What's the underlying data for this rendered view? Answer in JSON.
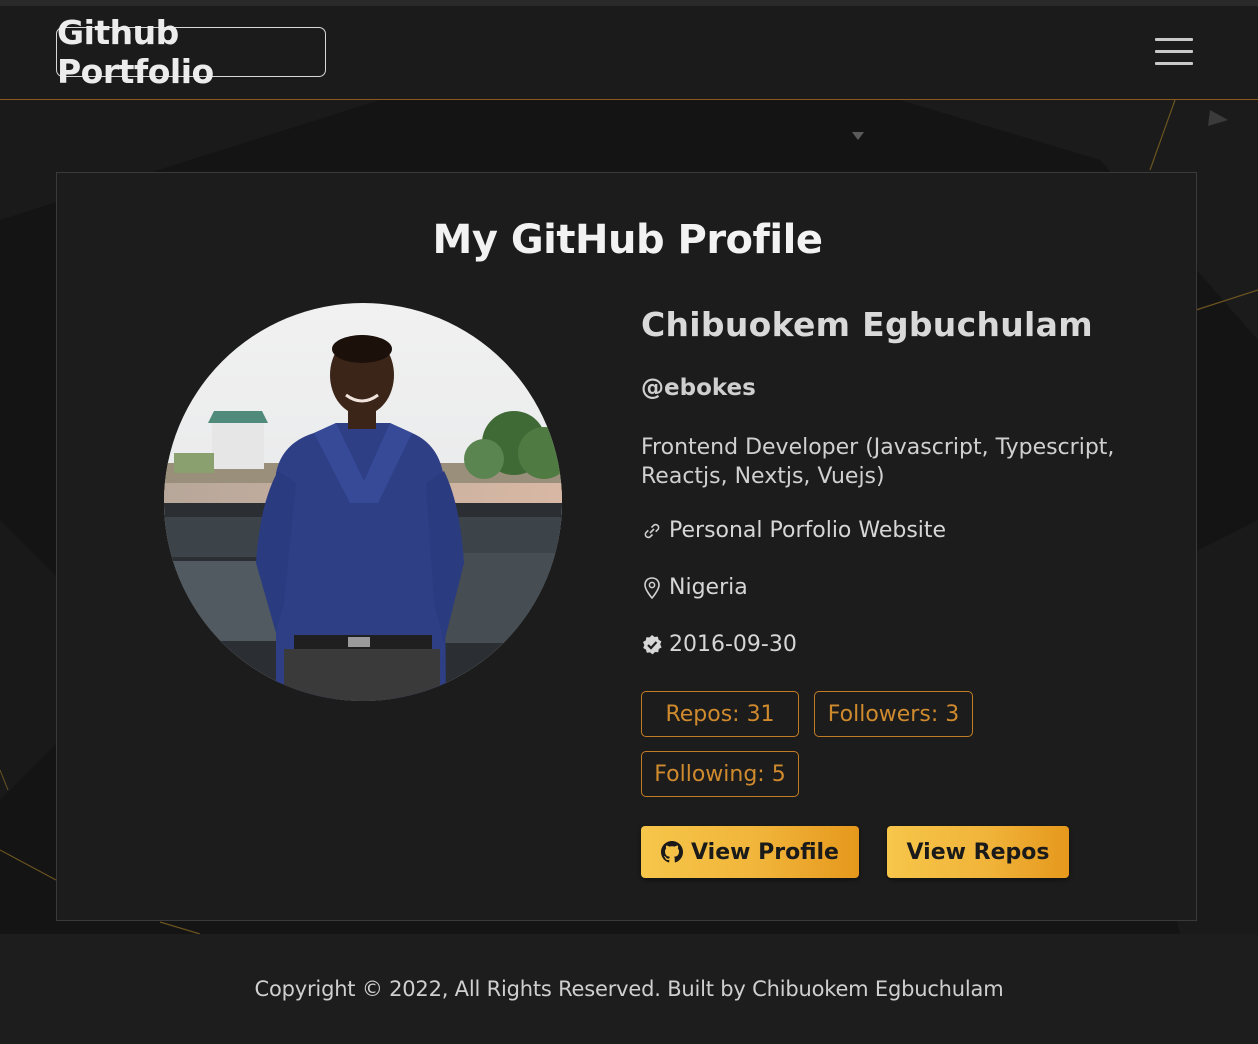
{
  "navbar": {
    "brand": "Github Portfolio",
    "menu_icon": "hamburger-menu-icon"
  },
  "card": {
    "title": "My GitHub Profile",
    "avatar_alt": "profile photo",
    "name": "Chibuokem Egbuchulam",
    "username": "@ebokes",
    "bio": "Frontend Developer (Javascript, Typescript, Reactjs, Nextjs, Vuejs)",
    "website_label": "Personal Porfolio Website",
    "location": "Nigeria",
    "joined": "2016-09-30",
    "stats": {
      "repos": "Repos: 31",
      "followers": "Followers: 3",
      "following": "Following: 5"
    },
    "buttons": {
      "view_profile": "View Profile",
      "view_repos": "View Repos"
    }
  },
  "footer": {
    "text": "Copyright © 2022, All Rights Reserved. Built by Chibuokem Egbuchulam"
  },
  "colors": {
    "accent": "#c27d24",
    "button_gradient_start": "#f6c64a",
    "button_gradient_end": "#e5981c",
    "background": "#1c1c1c"
  }
}
